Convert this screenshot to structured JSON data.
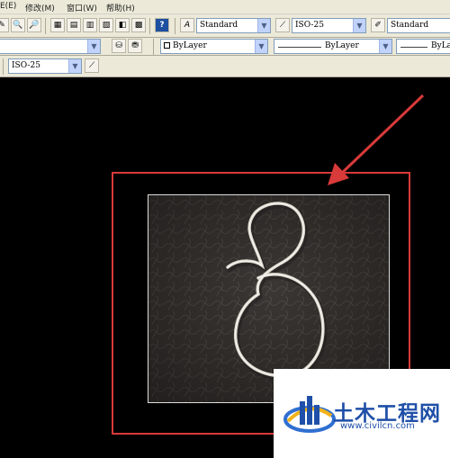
{
  "menus": {
    "m0": "E(E)",
    "m1": "修改(M)",
    "m2": "窗口(W)",
    "m3": "帮助(H)"
  },
  "styles": {
    "text_style": "Standard",
    "dim_style": "ISO-25",
    "table_style": "Standard",
    "dim_style_2": "ISO-25"
  },
  "properties": {
    "color": "ByLayer",
    "linetype": "ByLayer",
    "lineweight": "ByLayer"
  },
  "icons": {
    "help": "?",
    "calc": "calculator-icon"
  },
  "watermark": {
    "title": "土木工程网",
    "url": "www.civilcn.com"
  },
  "colors": {
    "frame": "#d93a3a",
    "arrow": "#d93a3a",
    "toolbar": "#ece9d8",
    "brand": "#1f4fa8"
  }
}
